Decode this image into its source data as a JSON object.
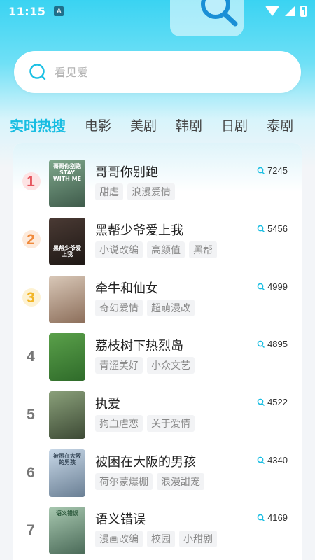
{
  "status_bar": {
    "time": "11:15",
    "notification_glyph": "A"
  },
  "search": {
    "placeholder": "看见爱"
  },
  "tabs": [
    {
      "label": "实时热搜",
      "active": true
    },
    {
      "label": "电影",
      "active": false
    },
    {
      "label": "美剧",
      "active": false
    },
    {
      "label": "韩剧",
      "active": false
    },
    {
      "label": "日剧",
      "active": false
    },
    {
      "label": "泰剧",
      "active": false
    }
  ],
  "list": [
    {
      "rank": "1",
      "title": "哥哥你别跑",
      "tags": [
        "甜虐",
        "浪漫爱情"
      ],
      "hot": "7245",
      "poster_text": "哥哥你别跑 STAY WITH ME",
      "poster_colors": [
        "#7fa88c",
        "#3e5a4a"
      ]
    },
    {
      "rank": "2",
      "title": "黑帮少爷爱上我",
      "tags": [
        "小说改编",
        "高颜值",
        "黑帮"
      ],
      "hot": "5456",
      "poster_text": "黑帮少爷爱上我",
      "poster_colors": [
        "#4a3a34",
        "#1d1714"
      ]
    },
    {
      "rank": "3",
      "title": "牵牛和仙女",
      "tags": [
        "奇幻爱情",
        "超萌漫改"
      ],
      "hot": "4999",
      "poster_text": "",
      "poster_colors": [
        "#d9c8b8",
        "#8c6e5a"
      ]
    },
    {
      "rank": "4",
      "title": "荔枝树下热烈岛",
      "tags": [
        "青涩美好",
        "小众文艺"
      ],
      "hot": "4895",
      "poster_text": "",
      "poster_colors": [
        "#5aa04a",
        "#2f6b2a"
      ]
    },
    {
      "rank": "5",
      "title": "执爱",
      "tags": [
        "狗血虐恋",
        "关于爱情"
      ],
      "hot": "4522",
      "poster_text": "",
      "poster_colors": [
        "#8aa07a",
        "#3d4a35"
      ]
    },
    {
      "rank": "6",
      "title": "被困在大阪的男孩",
      "tags": [
        "荷尔蒙爆棚",
        "浪漫甜宠"
      ],
      "hot": "4340",
      "poster_text": "被困在大阪的男孩",
      "poster_colors": [
        "#c8d8e8",
        "#6a7f94"
      ]
    },
    {
      "rank": "7",
      "title": "语义错误",
      "tags": [
        "漫画改编",
        "校园",
        "小甜剧"
      ],
      "hot": "4169",
      "poster_text": "语义错误",
      "poster_colors": [
        "#a8c8b0",
        "#4a6a58"
      ]
    }
  ],
  "colors": {
    "accent": "#17bde2",
    "rank1": "#e5555e",
    "rank2": "#f08a3c",
    "rank3": "#f2b526"
  }
}
